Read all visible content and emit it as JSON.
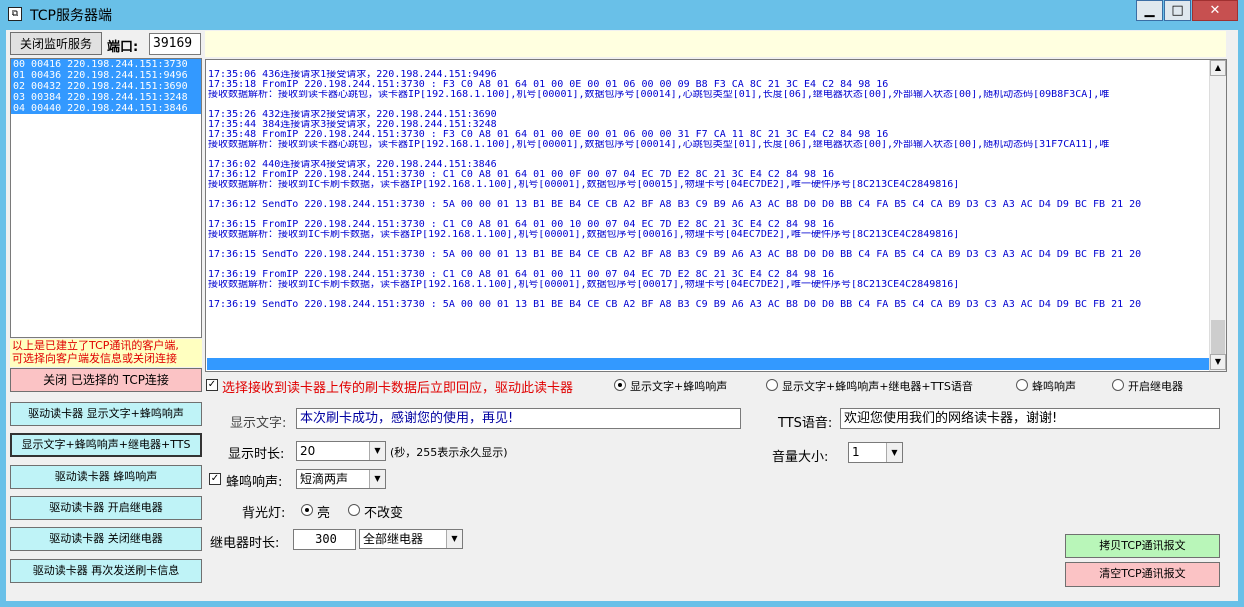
{
  "window": {
    "title": "TCP服务器端",
    "icon": "app-icon"
  },
  "title_buttons": {
    "minimize": "▁",
    "maximize": "□",
    "close": "✕"
  },
  "top": {
    "stop_listen_label": "关闭监听服务",
    "port_label": "端口:",
    "port_value": "39169"
  },
  "clients": [
    "00 00416 220.198.244.151:3730",
    "01 00436 220.198.244.151:9496",
    "02 00432 220.198.244.151:3690",
    "03 00384 220.198.244.151:3248",
    "04 00440 220.198.244.151:3846"
  ],
  "client_note": [
    "以上是已建立了TCP通讯的客户端,",
    "可选择向客户端发信息或关闭连接"
  ],
  "buttons": {
    "close_conn": "关闭 已选择的 TCP连接",
    "show_text_beep": "驱动读卡器 显示文字+蜂鸣响声",
    "show_text_relay_tts": "显示文字+蜂鸣响声+继电器+TTS",
    "beep": "驱动读卡器 蜂鸣响声",
    "open_relay": "驱动读卡器 开启继电器",
    "close_relay": "驱动读卡器 关闭继电器",
    "resend": "驱动读卡器 再次发送刷卡信息",
    "copy_log": "拷贝TCP通讯报文",
    "clear_log": "清空TCP通讯报文"
  },
  "log_lines": [
    "17:35:06 436连接请求1接受请求，220.198.244.151:9496",
    "17:35:18 FromIP 220.198.244.151:3730 : F3 C0 A8 01 64 01 00 0E 00 01 06 00 00 09 B8 F3 CA 8C 21 3C E4 C2 84 98 16",
    "接收数据解析：接收到读卡器心跳包，读卡器IP[192.168.1.100],机号[00001],数据包序号[00014],心跳包类型[01],长度[06],继电器状态[00],外部输入状态[00],随机动态码[09B8F3CA],唯",
    "",
    "17:35:26 432连接请求2接受请求，220.198.244.151:3690",
    "17:35:44 384连接请求3接受请求，220.198.244.151:3248",
    "17:35:48 FromIP 220.198.244.151:3730 : F3 C0 A8 01 64 01 00 0E 00 01 06 00 00 31 F7 CA 11 8C 21 3C E4 C2 84 98 16",
    "接收数据解析：接收到读卡器心跳包，读卡器IP[192.168.1.100],机号[00001],数据包序号[00014],心跳包类型[01],长度[06],继电器状态[00],外部输入状态[00],随机动态码[31F7CA11],唯",
    "",
    "17:36:02 440连接请求4接受请求，220.198.244.151:3846",
    "17:36:12 FromIP 220.198.244.151:3730 : C1 C0 A8 01 64 01 00 0F 00 07 04 EC 7D E2 8C 21 3C E4 C2 84 98 16",
    "接收数据解析：接收到IC卡刷卡数据，读卡器IP[192.168.1.100],机号[00001],数据包序号[00015],物理卡号[04EC7DE2],唯一硬件序号[8C213CE4C2849816]",
    "",
    "17:36:12 SendTo 220.198.244.151:3730 : 5A 00 00 01 13 B1 BE B4 CE CB A2 BF A8 B3 C9 B9 A6 A3 AC B8 D0 D0 BB C4 FA B5 C4 CA B9 D3 C3 A3 AC D4 D9 BC FB 21 20",
    "",
    "17:36:15 FromIP 220.198.244.151:3730 : C1 C0 A8 01 64 01 00 10 00 07 04 EC 7D E2 8C 21 3C E4 C2 84 98 16",
    "接收数据解析：接收到IC卡刷卡数据，读卡器IP[192.168.1.100],机号[00001],数据包序号[00016],物理卡号[04EC7DE2],唯一硬件序号[8C213CE4C2849816]",
    "",
    "17:36:15 SendTo 220.198.244.151:3730 : 5A 00 00 01 13 B1 BE B4 CE CB A2 BF A8 B3 C9 B9 A6 A3 AC B8 D0 D0 BB C4 FA B5 C4 CA B9 D3 C3 A3 AC D4 D9 BC FB 21 20",
    "",
    "17:36:19 FromIP 220.198.244.151:3730 : C1 C0 A8 01 64 01 00 11 00 07 04 EC 7D E2 8C 21 3C E4 C2 84 98 16",
    "接收数据解析：接收到IC卡刷卡数据，读卡器IP[192.168.1.100],机号[00001],数据包序号[00017],物理卡号[04EC7DE2],唯一硬件序号[8C213CE4C2849816]",
    "",
    "17:36:19 SendTo 220.198.244.151:3730 : 5A 00 00 01 13 B1 BE B4 CE CB A2 BF A8 B3 C9 B9 A6 A3 AC B8 D0 D0 BB C4 FA B5 C4 CA B9 D3 C3 A3 AC D4 D9 BC FB 21 20"
  ],
  "options": {
    "auto_reply_label": "选择接收到读卡器上传的刷卡数据后立即回应，驱动此读卡器",
    "auto_reply_checked": true,
    "modes": [
      {
        "label": "显示文字+蜂鸣响声",
        "selected": true
      },
      {
        "label": "显示文字+蜂鸣响声+继电器+TTS语音",
        "selected": false
      },
      {
        "label": "蜂鸣响声",
        "selected": false
      },
      {
        "label": "开启继电器",
        "selected": false
      }
    ]
  },
  "form": {
    "display_text_label": "显示文字:",
    "display_text_value": "本次刷卡成功，感谢您的使用，再见!",
    "tts_label": "TTS语音:",
    "tts_value": "欢迎您使用我们的网络读卡器，谢谢!",
    "duration_label": "显示时长:",
    "duration_value": "20",
    "duration_hint": "(秒，255表示永久显示)",
    "volume_label": "音量大小:",
    "volume_value": "1",
    "beep_label": "蜂鸣响声:",
    "beep_checked": true,
    "beep_value": "短滴两声",
    "backlight_label": "背光灯:",
    "backlight_on_label": "亮",
    "backlight_off_label": "不改变",
    "backlight_selected": "on",
    "relay_duration_label": "继电器时长:",
    "relay_duration_value": "300",
    "relay_select_value": "全部继电器"
  },
  "colors": {
    "title_bar": "#69c0e8",
    "selection": "#3399ff",
    "log_text": "#0000d0",
    "note_text": "#e00000",
    "auto_reply_text": "#e00000"
  }
}
